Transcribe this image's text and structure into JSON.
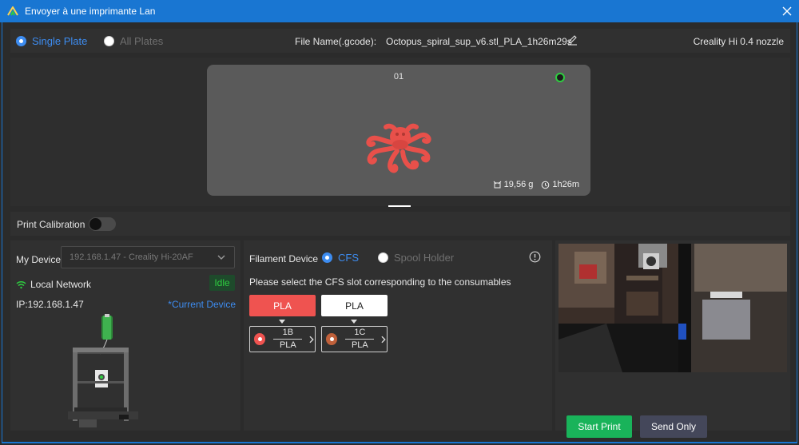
{
  "window": {
    "title": "Envoyer à une imprimante Lan"
  },
  "plates": {
    "single_label": "Single Plate",
    "all_label": "All Plates"
  },
  "file": {
    "label": "File Name(.gcode):",
    "name": "Octopus_spiral_sup_v6.stl_PLA_1h26m29s"
  },
  "nozzle": "Creality Hi 0.4 nozzle",
  "plate": {
    "number": "01",
    "weight": "19,56 g",
    "time": "1h26m"
  },
  "calibration": {
    "label": "Print Calibration",
    "enabled": false
  },
  "device": {
    "label": "My Device",
    "selected": "192.168.1.47 - Creality Hi-20AF",
    "network": "Local Network",
    "status": "Idle",
    "ip": "IP:192.168.1.47",
    "current": "*Current Device"
  },
  "filament": {
    "label": "Filament Device",
    "cfs_label": "CFS",
    "spool_label": "Spool Holder",
    "message": "Please select the CFS slot corresponding to the consumables",
    "materials": [
      {
        "name": "PLA",
        "color": "#ef5350"
      },
      {
        "name": "PLA",
        "color": "#ffffff"
      }
    ],
    "slots": [
      {
        "id": "1B",
        "type": "PLA",
        "color": "#ef5350"
      },
      {
        "id": "1C",
        "type": "PLA",
        "color": "#c0603a"
      }
    ]
  },
  "actions": {
    "start": "Start Print",
    "send": "Send Only"
  },
  "colors": {
    "accent": "#3d8cf0",
    "title_bar": "#1976d2",
    "start": "#19b35a",
    "idle": "#2ecc40"
  }
}
